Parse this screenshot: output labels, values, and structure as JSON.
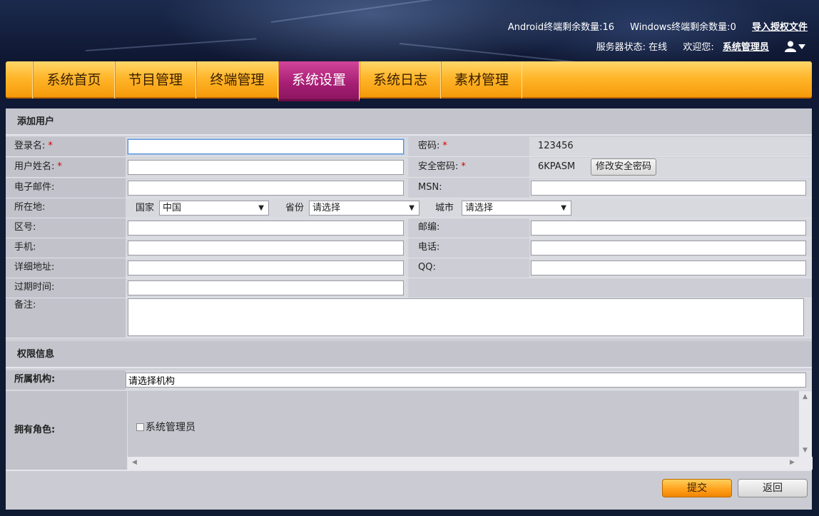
{
  "header": {
    "android_remaining": "Android终端剩余数量:16",
    "windows_remaining": "Windows终端剩余数量:0",
    "import_license": "导入授权文件",
    "server_status": "服务器状态: 在线",
    "welcome": "欢迎您:",
    "username": "系统管理员",
    "user_icon": "user-icon"
  },
  "nav": {
    "items": [
      {
        "label": "系统首页",
        "active": false
      },
      {
        "label": "节目管理",
        "active": false
      },
      {
        "label": "终端管理",
        "active": false
      },
      {
        "label": "系统设置",
        "active": true
      },
      {
        "label": "系统日志",
        "active": false
      },
      {
        "label": "素材管理",
        "active": false
      }
    ]
  },
  "form": {
    "section_title": "添加用户",
    "login_name_label": "登录名:",
    "password_label": "密码:",
    "password_value": "123456",
    "real_name_label": "用户姓名:",
    "security_pwd_label": "安全密码:",
    "security_pwd_value": "6KPASM",
    "change_security_pwd": "修改安全密码",
    "email_label": "电子邮件:",
    "msn_label": "MSN:",
    "location_label": "所在地:",
    "country_label": "国家",
    "country_value": "中国",
    "province_label": "省份",
    "province_value": "请选择",
    "city_label": "城市",
    "city_value": "请选择",
    "area_code_label": "区号:",
    "postcode_label": "邮编:",
    "mobile_label": "手机:",
    "phone_label": "电话:",
    "address_label": "详细地址:",
    "qq_label": "QQ:",
    "expire_label": "过期时间:",
    "remark_label": "备注:",
    "required_mark": "*"
  },
  "permissions": {
    "section_title": "权限信息",
    "org_label": "所属机构:",
    "org_value": "请选择机构",
    "roles_label": "拥有角色:",
    "roles": [
      {
        "label": "系统管理员",
        "checked": false
      }
    ]
  },
  "actions": {
    "submit": "提交",
    "back": "返回"
  },
  "colors": {
    "nav_orange": "#f59a0a",
    "nav_active": "#a51e73",
    "panel_gray": "#cfd0d7"
  }
}
